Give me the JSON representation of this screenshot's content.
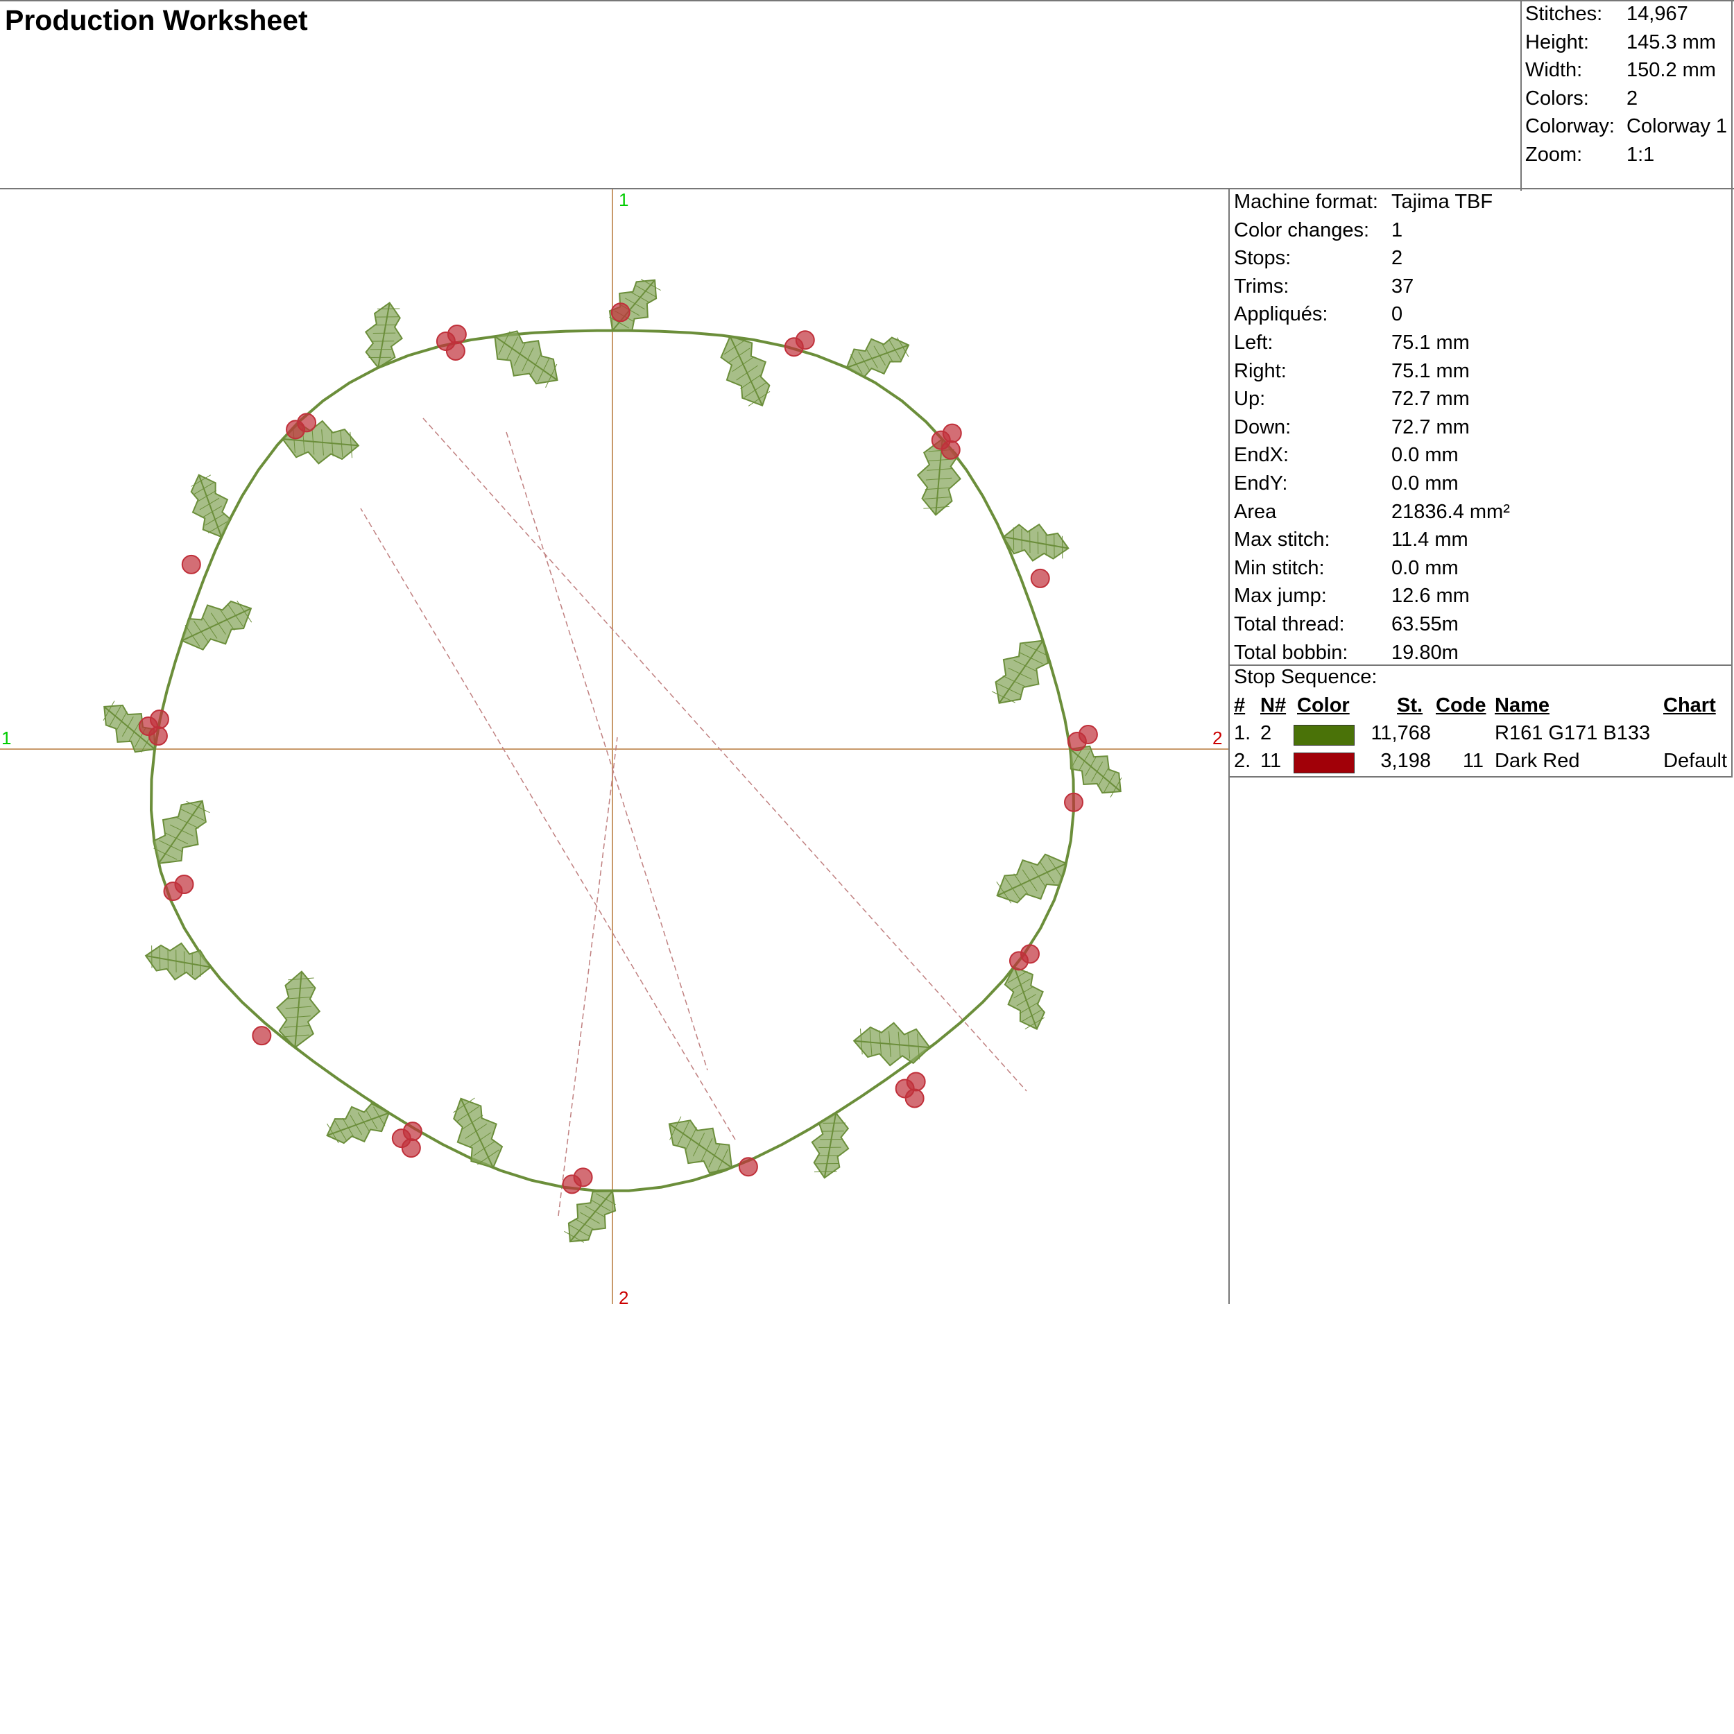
{
  "page": {
    "title": "Production Worksheet"
  },
  "summary": [
    {
      "label": "Stitches:",
      "value": "14,967"
    },
    {
      "label": "Height:",
      "value": "145.3 mm"
    },
    {
      "label": "Width:",
      "value": "150.2 mm"
    },
    {
      "label": "Colors:",
      "value": "2"
    },
    {
      "label": "Colorway:",
      "value": "Colorway 1"
    },
    {
      "label": "Zoom:",
      "value": "1:1"
    }
  ],
  "info": [
    {
      "label": "Machine format:",
      "value": "Tajima TBF"
    },
    {
      "label": "Color changes:",
      "value": "1"
    },
    {
      "label": "Stops:",
      "value": "2"
    },
    {
      "label": "Trims:",
      "value": "37"
    },
    {
      "label": "Appliqués:",
      "value": "0"
    },
    {
      "label": "Left:",
      "value": "75.1 mm"
    },
    {
      "label": "Right:",
      "value": "75.1 mm"
    },
    {
      "label": "Up:",
      "value": "72.7 mm"
    },
    {
      "label": "Down:",
      "value": "72.7 mm"
    },
    {
      "label": "EndX:",
      "value": "0.0 mm"
    },
    {
      "label": "EndY:",
      "value": "0.0 mm"
    },
    {
      "label": "Area",
      "value": "21836.4 mm²"
    },
    {
      "label": "Max stitch:",
      "value": "11.4 mm"
    },
    {
      "label": "Min stitch:",
      "value": "0.0 mm"
    },
    {
      "label": "Max jump:",
      "value": "12.6 mm"
    },
    {
      "label": "Total thread:",
      "value": "63.55m"
    },
    {
      "label": "Total bobbin:",
      "value": "19.80m"
    }
  ],
  "stop_sequence": {
    "title": "Stop Sequence:",
    "headers": {
      "index": "#",
      "n": "N#",
      "color": "Color",
      "stitches": "St.",
      "code": "Code",
      "name": "Name",
      "chart": "Chart"
    },
    "rows": [
      {
        "index": "1.",
        "n": "2",
        "swatch": "#4a7208",
        "stitches": "11,768",
        "code": "",
        "name": "R161 G171 B133",
        "chart": ""
      },
      {
        "index": "2.",
        "n": "11",
        "swatch": "#a10008",
        "stitches": "3,198",
        "code": "11",
        "name": "Dark Red",
        "chart": "Default"
      }
    ]
  },
  "axes": {
    "top": "1",
    "bottom": "2",
    "left": "1",
    "right": "2",
    "color_start": "#00cc00",
    "color_end": "#cc0000",
    "line_color": "#b87333"
  },
  "design": {
    "leaf_color": "#6b8e3a",
    "leaf_fill": "#8aa860",
    "berry_color": "#c0303a",
    "jump_color": "#c08080"
  }
}
